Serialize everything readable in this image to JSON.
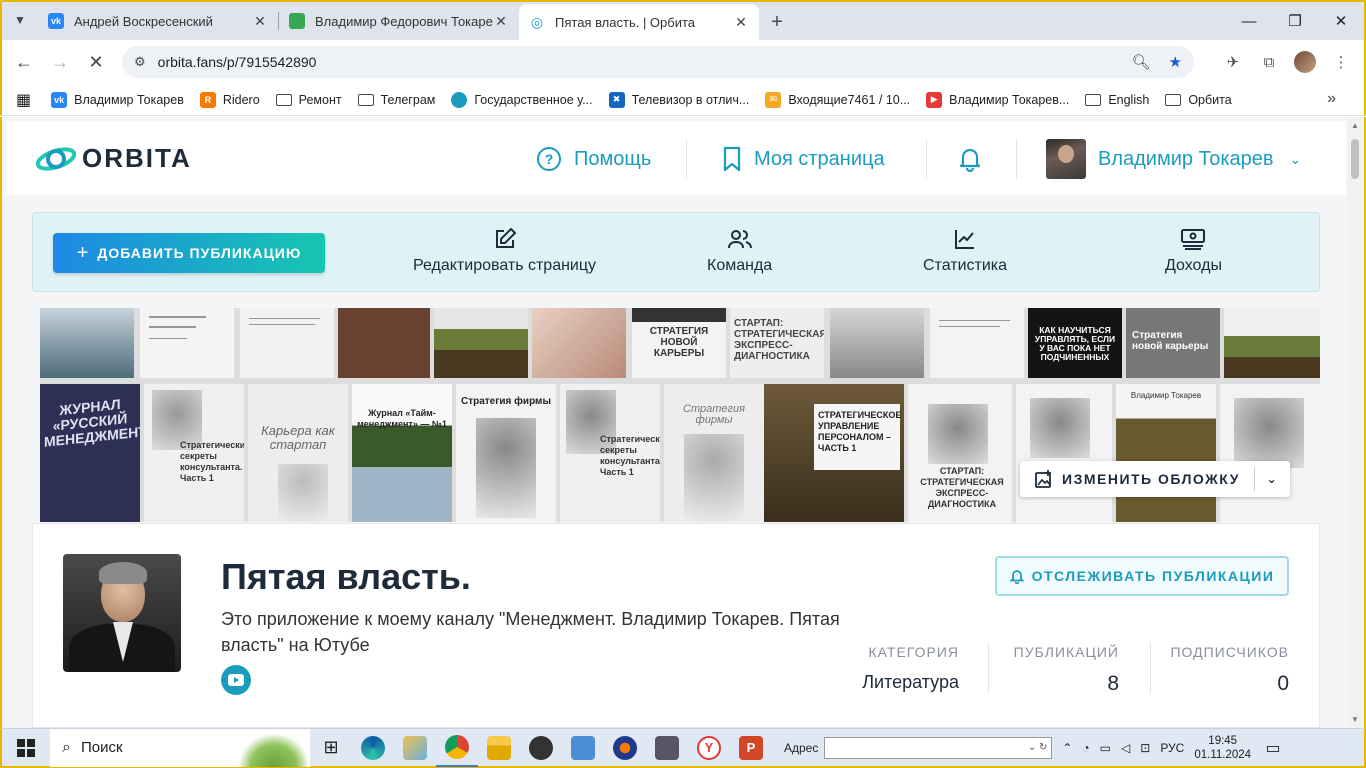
{
  "browser": {
    "tabs": [
      {
        "title": "Андрей Воскресенский",
        "icon": "vk-icon",
        "color": "#2787f5"
      },
      {
        "title": "Владимир Федорович Токарев",
        "icon": "sheets-icon",
        "color": "#34a853"
      },
      {
        "title": "Пятая власть. | Орбита",
        "icon": "orbita-icon",
        "color": "#1a9cbf"
      }
    ],
    "url": "orbita.fans/p/7915542890",
    "bookmarks": [
      {
        "label": "Владимир Токарев",
        "icon": "vk-icon",
        "color": "#2787f5"
      },
      {
        "label": "Ridero",
        "icon": "ridero-icon",
        "color": "#f57c00"
      },
      {
        "label": "Ремонт",
        "icon": "folder-icon"
      },
      {
        "label": "Телеграм",
        "icon": "folder-icon"
      },
      {
        "label": "Государственное у...",
        "icon": "gosuslugi-icon",
        "color": "#1a9cbf"
      },
      {
        "label": "Телевизор в отлич...",
        "icon": "avito-icon",
        "color": "#1565c0"
      },
      {
        "label": "Входящие7461 / 10...",
        "icon": "mail-icon",
        "color": "#e53935"
      },
      {
        "label": "Владимир Токарев...",
        "icon": "youtube-icon",
        "color": "#e53935"
      },
      {
        "label": "English",
        "icon": "folder-icon"
      },
      {
        "label": "Орбита",
        "icon": "folder-icon"
      }
    ]
  },
  "site": {
    "logo": "ORBITA",
    "nav": {
      "help": "Помощь",
      "my_page": "Моя страница",
      "user_name": "Владимир Токарев"
    },
    "toolbar": {
      "add_publication": "ДОБАВИТЬ ПУБЛИКАЦИЮ",
      "edit_page": "Редактировать страницу",
      "team": "Команда",
      "statistics": "Статистика",
      "income": "Доходы"
    },
    "cover": {
      "change_cover": "ИЗМЕНИТЬ ОБЛОЖКУ",
      "book_titles": {
        "journal": "ЖУРНАЛ «РУССКИЙ МЕНЕДЖМЕНТ»",
        "career": "Карьера как стартап",
        "tuesday": "Журнал «Тайм-менеджмент» — №1",
        "strategy_firm": "Стратегия фирмы",
        "strategy_firm2": "Стратегия фирмы",
        "strategic_mgmt": "СТРАТЕГИЧЕСКОЕ УПРАВЛЕНИЕ ПЕРСОНАЛОМ – ЧАСТЬ 1",
        "startup": "СТАРТАП: СТРАТЕГИЧЕСКАЯ ЭКСПРЕСС-ДИАГНОСТИКА",
        "how_to_learn": "КАК НАУЧИТЬСЯ УПРАВЛЯТЬ, ЕСЛИ У ВАС ПОКА НЕТ ПОДЧИНЕННЫХ",
        "new_career": "Стратегия новой карьеры",
        "new_career2": "СТРАТЕГИЯ НОВОЙ КАРЬЕРЫ",
        "startup2": "СТАРТАП: СТРАТЕГИЧЕСКАЯ ЭКСПРЕСС-ДИАГНОСТИКА",
        "secrets": "Стратегические секреты консультанта. Часть 1",
        "author": "Владимир Токарев"
      }
    },
    "profile": {
      "name": "Пятая власть.",
      "description": "Это приложение к моему каналу \"Менеджмент. Владимир Токарев. Пятая власть\" на Ютубе",
      "follow_button": "ОТСЛЕЖИВАТЬ ПУБЛИКАЦИИ",
      "stats": {
        "category_label": "КАТЕГОРИЯ",
        "category_value": "Литература",
        "publications_label": "ПУБЛИКАЦИЙ",
        "publications_value": "8",
        "subscribers_label": "ПОДПИСЧИКОВ",
        "subscribers_value": "0"
      }
    },
    "accent_color": "#1a9cbf"
  },
  "taskbar": {
    "search_placeholder": "Поиск",
    "address_label": "Адрес",
    "language": "РУС",
    "time": "19:45",
    "date": "01.11.2024"
  }
}
